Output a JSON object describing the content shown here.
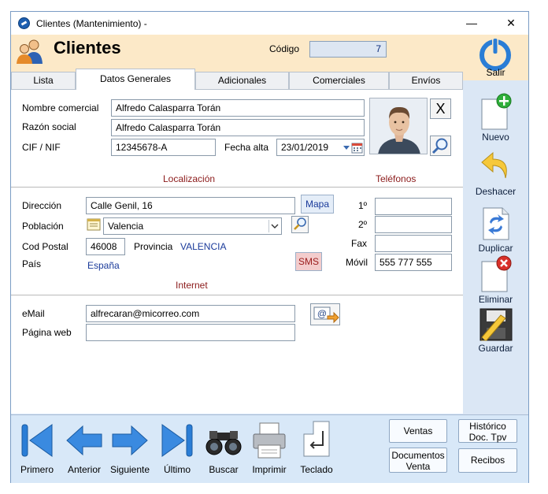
{
  "window": {
    "title": "Clientes (Mantenimiento) -",
    "minimize": "—",
    "close": "✕"
  },
  "header": {
    "title": "Clientes",
    "codigo_label": "Código",
    "codigo_value": "7",
    "exit_label": "Salir"
  },
  "tabs": [
    {
      "label": "Lista"
    },
    {
      "label": "Datos Generales",
      "active": true
    },
    {
      "label": "Adicionales"
    },
    {
      "label": "Comerciales"
    },
    {
      "label": "Envíos"
    }
  ],
  "general": {
    "nombre_label": "Nombre comercial",
    "nombre_value": "Alfredo Calasparra Torán",
    "razon_label": "Razón social",
    "razon_value": "Alfredo Calasparra Torán",
    "cif_label": "CIF / NIF",
    "cif_value": "12345678-A",
    "fecha_label": "Fecha alta",
    "fecha_value": "23/01/2019",
    "remove_photo": "X"
  },
  "sections": {
    "localizacion": "Localización",
    "telefonos": "Teléfonos",
    "internet": "Internet"
  },
  "location": {
    "direccion_label": "Dirección",
    "direccion_value": "Calle Genil, 16",
    "mapa_button": "Mapa",
    "poblacion_label": "Población",
    "poblacion_value": "Valencia",
    "cp_label": "Cod Postal",
    "cp_value": "46008",
    "provincia_label": "Provincia",
    "provincia_value": "VALENCIA",
    "pais_label": "País",
    "pais_value": "España",
    "sms_button": "SMS"
  },
  "phones": {
    "p1_label": "1º",
    "p1_value": "",
    "p2_label": "2º",
    "p2_value": "",
    "fax_label": "Fax",
    "fax_value": "",
    "movil_label": "Móvil",
    "movil_value": "555 777 555"
  },
  "internet": {
    "email_label": "eMail",
    "email_value": "alfrecaran@micorreo.com",
    "web_label": "Página web",
    "web_value": ""
  },
  "sidebar": [
    {
      "label": "Nuevo"
    },
    {
      "label": "Deshacer"
    },
    {
      "label": "Duplicar"
    },
    {
      "label": "Eliminar"
    },
    {
      "label": "Guardar"
    }
  ],
  "nav": [
    {
      "label": "Primero"
    },
    {
      "label": "Anterior"
    },
    {
      "label": "Siguiente"
    },
    {
      "label": "Último"
    },
    {
      "label": "Buscar"
    },
    {
      "label": "Imprimir"
    },
    {
      "label": "Teclado"
    }
  ],
  "actions": {
    "ventas": "Ventas",
    "historico_1": "Histórico",
    "historico_2": "Doc. Tpv",
    "documentos_1": "Documentos",
    "documentos_2": "Venta",
    "recibos": "Recibos"
  },
  "colors": {
    "header_bg": "#fce9c8",
    "section_title": "#8b1a1a",
    "link": "#1a3a9a",
    "window_bg": "#d8e8f8"
  }
}
